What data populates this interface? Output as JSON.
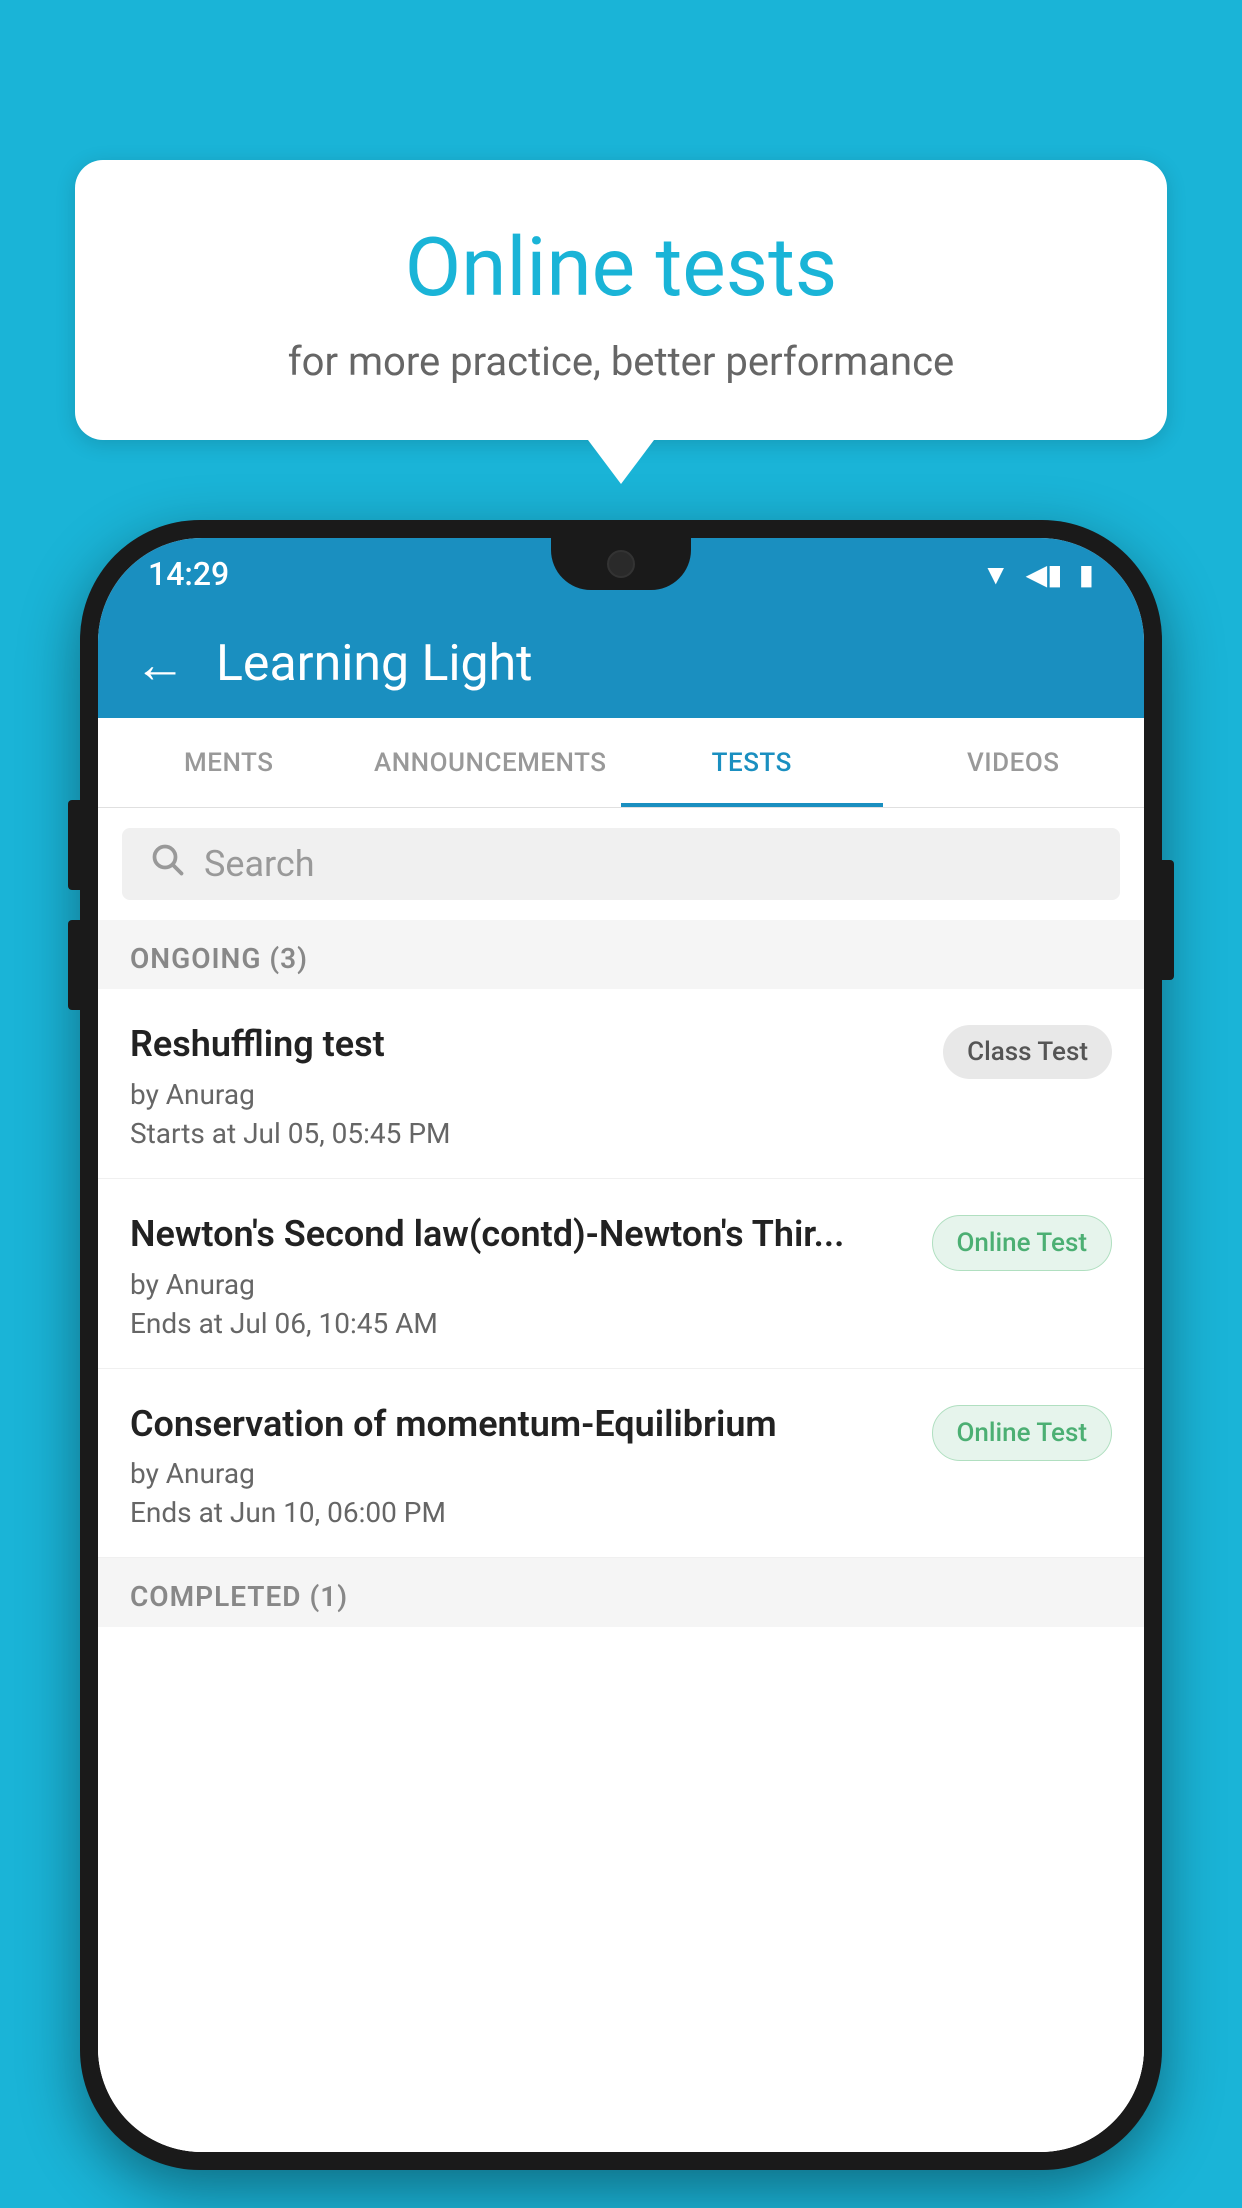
{
  "background": {
    "color": "#1ab4d7"
  },
  "hero": {
    "title": "Online tests",
    "subtitle": "for more practice, better performance"
  },
  "phone": {
    "status_bar": {
      "time": "14:29",
      "icons": [
        "wifi",
        "signal",
        "battery"
      ]
    },
    "app_bar": {
      "title": "Learning Light",
      "back_label": "←"
    },
    "tabs": [
      {
        "label": "MENTS",
        "active": false
      },
      {
        "label": "ANNOUNCEMENTS",
        "active": false
      },
      {
        "label": "TESTS",
        "active": true
      },
      {
        "label": "VIDEOS",
        "active": false
      }
    ],
    "search": {
      "placeholder": "Search"
    },
    "ongoing_section": {
      "label": "ONGOING (3)"
    },
    "tests": [
      {
        "name": "Reshuffling test",
        "author": "by Anurag",
        "date": "Starts at  Jul 05, 05:45 PM",
        "badge": "Class Test",
        "badge_type": "class"
      },
      {
        "name": "Newton's Second law(contd)-Newton's Thir...",
        "author": "by Anurag",
        "date": "Ends at  Jul 06, 10:45 AM",
        "badge": "Online Test",
        "badge_type": "online"
      },
      {
        "name": "Conservation of momentum-Equilibrium",
        "author": "by Anurag",
        "date": "Ends at  Jun 10, 06:00 PM",
        "badge": "Online Test",
        "badge_type": "online"
      }
    ],
    "completed_section": {
      "label": "COMPLETED (1)"
    }
  }
}
